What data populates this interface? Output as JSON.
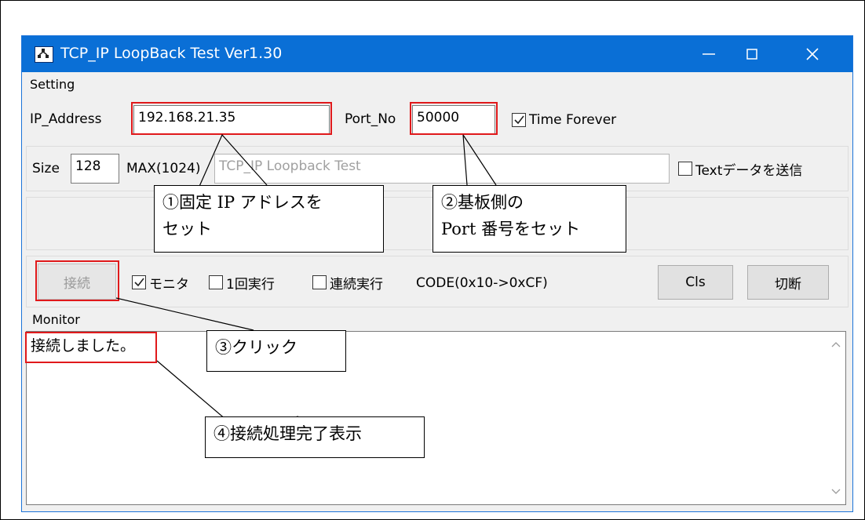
{
  "window": {
    "title": "TCP_IP LoopBack Test Ver1.30",
    "title_bar_color": "#0a6fd6",
    "icons": [
      "app-icon",
      "minimize-icon",
      "maximize-icon",
      "close-icon"
    ]
  },
  "setting": {
    "section_label": "Setting",
    "ip_label": "IP_Address",
    "ip_value": "192.168.21.35",
    "port_label": "Port_No",
    "port_value": "50000",
    "time_forever_label": "Time Forever",
    "time_forever_checked": true
  },
  "data_row": {
    "size_label": "Size",
    "size_value": "128",
    "max_label": "MAX(1024)",
    "text_value": "TCP_IP Loopback Test",
    "send_text_label": "Textデータを送信",
    "send_text_checked": false
  },
  "controls": {
    "connect_button": "接続",
    "monitor_label": "モニタ",
    "monitor_checked": true,
    "once_label": "1回実行",
    "once_checked": false,
    "continuous_label": "連続実行",
    "continuous_checked": false,
    "code_label": "CODE(0x10->0xCF)",
    "cls_button": "Cls",
    "disconnect_button": "切断"
  },
  "monitor": {
    "section_label": "Monitor",
    "text": "接続しました。"
  },
  "annotations": {
    "note1_line1": "①固定 IP アドレスを",
    "note1_line2": "セット",
    "note2_line1": "②基板側の",
    "note2_line2": "Port 番号をセット",
    "note3": "③クリック",
    "note4": "④接続処理完了表示",
    "highlight_color": "#e0191b"
  }
}
